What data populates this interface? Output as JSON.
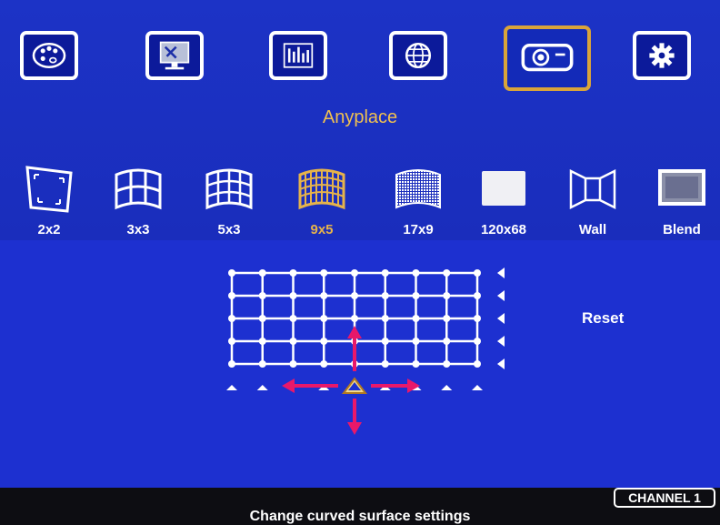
{
  "menu": {
    "items": [
      {
        "icon": "palette-icon"
      },
      {
        "icon": "monitor-tools-icon"
      },
      {
        "icon": "mixer-sliders-icon"
      },
      {
        "icon": "globe-icon"
      },
      {
        "icon": "projector-icon",
        "active": true
      },
      {
        "icon": "gear-icon"
      }
    ],
    "section_title": "Anyplace"
  },
  "modes": [
    {
      "label": "2x2",
      "icon": "corner-warp-icon"
    },
    {
      "label": "3x3",
      "icon": "grid-3x3-icon"
    },
    {
      "label": "5x3",
      "icon": "grid-5x3-icon"
    },
    {
      "label": "9x5",
      "icon": "grid-9x5-icon",
      "active": true
    },
    {
      "label": "17x9",
      "icon": "grid-17x9-icon"
    },
    {
      "label": "120x68",
      "icon": "grid-120x68-icon"
    },
    {
      "label": "Wall",
      "icon": "wall-icon"
    },
    {
      "label": "Blend",
      "icon": "blend-icon"
    }
  ],
  "reset_label": "Reset",
  "channel_label": "CHANNEL 1",
  "hint": "Change curved surface settings",
  "colors": {
    "background": "#1d30d0",
    "active_accent": "#d9a43a",
    "arrow": "#e8186a",
    "text": "#ffffff"
  }
}
